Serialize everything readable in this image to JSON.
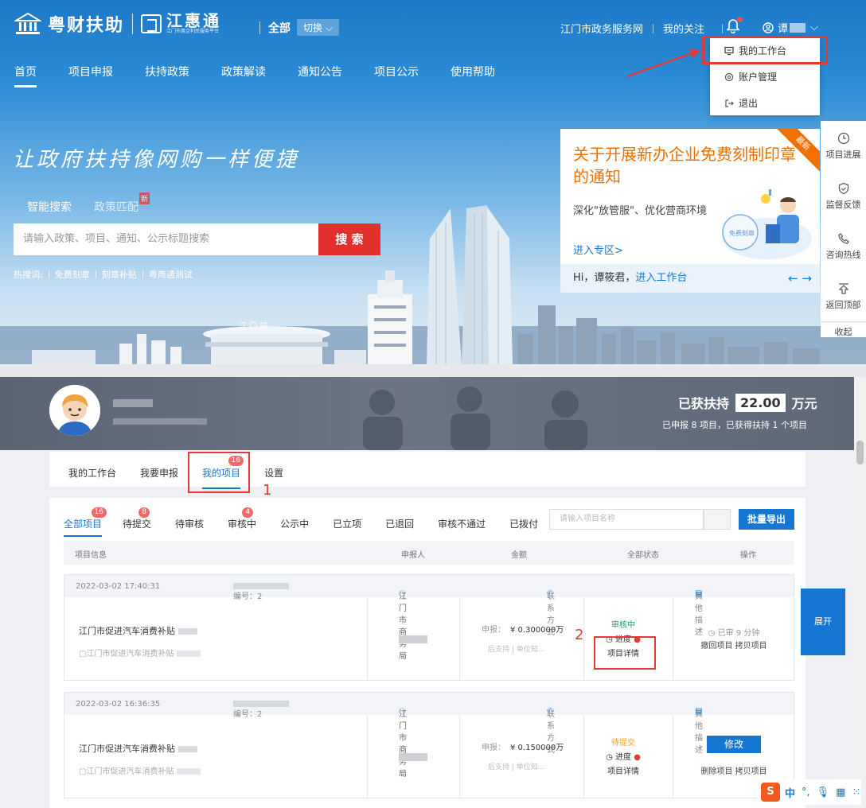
{
  "header": {
    "brand": "粤财扶助",
    "sub_brand": "江惠通",
    "sub_brand_tagline": "江门市惠企利民服务平台",
    "scope_label": "全部",
    "switch_label": "切换",
    "gov_link": "江门市政务服务网",
    "follow_link": "我的关注",
    "user_name": "谭"
  },
  "nav": {
    "items": [
      "首页",
      "项目申报",
      "扶持政策",
      "政策解读",
      "通知公告",
      "项目公示",
      "使用帮助"
    ]
  },
  "user_menu": {
    "items": [
      "我的工作台",
      "账户管理",
      "退出"
    ]
  },
  "hero": {
    "slogan": "让政府扶持像网购一样便捷",
    "search_tab": "智能搜索",
    "match_tab": "政策匹配",
    "new_badge": "新",
    "search_placeholder": "请输入政策、项目、通知、公示标题搜索",
    "search_button": "搜 索",
    "hot_label": "热搜词:",
    "hot_words": [
      "免费刻章",
      "刻章补贴",
      "粤商通测试"
    ],
    "city_sign": "江 门 站"
  },
  "notice_card": {
    "ribbon": "最新",
    "title": "关于开展新办企业免费刻制印章的通知",
    "subtitle": "深化\"放管服\"、优化营商环境",
    "link": "进入专区>",
    "stamp": "免费刻章",
    "greeting": "Hi，谭筱君，",
    "workbench_link": "进入工作台",
    "arrows": "← →"
  },
  "side_tools": {
    "items": [
      "项目进展",
      "监督反馈",
      "咨询热线",
      "返回顶部"
    ],
    "collapse": "收起"
  },
  "workbench": {
    "support_label": "已获扶持",
    "support_amount": "22.00",
    "support_unit": "万元",
    "support_summary": "已申报 8 项目，已获得扶持 1 个项目",
    "tabs": [
      "我的工作台",
      "我要申报",
      "我的项目",
      "设置"
    ],
    "my_projects_badge": "16",
    "annotation_1": "1",
    "annotation_2": "2",
    "filters": [
      {
        "label": "全部项目",
        "badge": "16"
      },
      {
        "label": "待提交",
        "badge": "8"
      },
      {
        "label": "待审核",
        "badge": ""
      },
      {
        "label": "审核中",
        "badge": "4"
      },
      {
        "label": "公示中",
        "badge": ""
      },
      {
        "label": "已立项",
        "badge": ""
      },
      {
        "label": "已退回",
        "badge": ""
      },
      {
        "label": "审核不通过",
        "badge": ""
      },
      {
        "label": "已拨付",
        "badge": ""
      }
    ],
    "search_placeholder": "请输入项目名称",
    "export_button": "批量导出",
    "columns": [
      "项目信息",
      "申报人",
      "金额",
      "全部状态",
      "操作"
    ],
    "expand_button": "展开"
  },
  "records": [
    {
      "time": "2022-03-02 17:40:31",
      "code_label": "编号：2",
      "dept": "江门市商务局",
      "contact": "联系方式",
      "other": "其他描述",
      "name": "江门市促进汽车消费补贴",
      "sub": "江门市促进汽车消费补贴",
      "amount_label": "申报：",
      "amount": "¥ 0.300000万",
      "amount_sub": "后支持 | 单位知...",
      "status": "审核中",
      "progress": "进度",
      "detail": "项目详情",
      "time_ago": "已审 9 分钟",
      "actions": "撤回项目  拷贝项目"
    },
    {
      "time": "2022-03-02 16:36:35",
      "code_label": "编号：2",
      "dept": "江门市商务局",
      "contact": "联系方式",
      "other": "其他描述",
      "name": "江门市促进汽车消费补贴",
      "sub": "江门市促进汽车消费补贴",
      "amount_label": "申报：",
      "amount": "¥ 0.150000万",
      "amount_sub": "后支持 | 单位知...",
      "status": "待提交",
      "progress": "进度",
      "detail": "项目详情",
      "modify": "修改",
      "actions": "删除项目  拷贝项目"
    }
  ],
  "ime": {
    "logo": "S",
    "mode": "中",
    "punct": "°,"
  },
  "colors": {
    "primary": "#1677d2",
    "accent_red": "#e53935",
    "orange": "#f07000",
    "banner": "#5e6878"
  }
}
